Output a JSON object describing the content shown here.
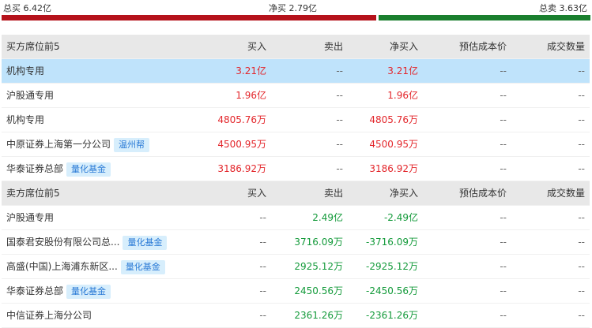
{
  "summary": {
    "buy_total": "总买 6.42亿",
    "net_buy": "净买 2.79亿",
    "sell_total": "总卖 3.63亿",
    "buy_fraction": 0.639
  },
  "colors": {
    "buy": "#b5121b",
    "sell": "#1a7f2e",
    "up": "#e3262b",
    "down": "#139a3a",
    "tag_bg": "#d7eefc",
    "tag_text": "#2b7bd6"
  },
  "buy_section": {
    "headers": [
      "买方席位前5",
      "买入",
      "卖出",
      "净买入",
      "预估成本价",
      "成交数量"
    ],
    "rows": [
      {
        "name": "机构专用",
        "tag": "",
        "buy": "3.21亿",
        "sell": "--",
        "net": "3.21亿",
        "cost": "--",
        "vol": "--"
      },
      {
        "name": "沪股通专用",
        "tag": "",
        "buy": "1.96亿",
        "sell": "--",
        "net": "1.96亿",
        "cost": "--",
        "vol": "--"
      },
      {
        "name": "机构专用",
        "tag": "",
        "buy": "4805.76万",
        "sell": "--",
        "net": "4805.76万",
        "cost": "--",
        "vol": "--"
      },
      {
        "name": "中原证券上海第一分公司",
        "tag": "温州帮",
        "buy": "4500.95万",
        "sell": "--",
        "net": "4500.95万",
        "cost": "--",
        "vol": "--"
      },
      {
        "name": "华泰证券总部",
        "tag": "量化基金",
        "buy": "3186.92万",
        "sell": "--",
        "net": "3186.92万",
        "cost": "--",
        "vol": "--"
      }
    ]
  },
  "sell_section": {
    "headers": [
      "卖方席位前5",
      "买入",
      "卖出",
      "净买入",
      "预估成本价",
      "成交数量"
    ],
    "rows": [
      {
        "name": "沪股通专用",
        "tag": "",
        "buy": "--",
        "sell": "2.49亿",
        "net": "-2.49亿",
        "cost": "--",
        "vol": "--"
      },
      {
        "name": "国泰君安股份有限公司总...",
        "tag": "量化基金",
        "buy": "--",
        "sell": "3716.09万",
        "net": "-3716.09万",
        "cost": "--",
        "vol": "--"
      },
      {
        "name": "高盛(中国)上海浦东新区...",
        "tag": "量化基金",
        "buy": "--",
        "sell": "2925.12万",
        "net": "-2925.12万",
        "cost": "--",
        "vol": "--"
      },
      {
        "name": "华泰证券总部",
        "tag": "量化基金",
        "buy": "--",
        "sell": "2450.56万",
        "net": "-2450.56万",
        "cost": "--",
        "vol": "--"
      },
      {
        "name": "中信证券上海分公司",
        "tag": "",
        "buy": "--",
        "sell": "2361.26万",
        "net": "-2361.26万",
        "cost": "--",
        "vol": "--"
      }
    ]
  }
}
